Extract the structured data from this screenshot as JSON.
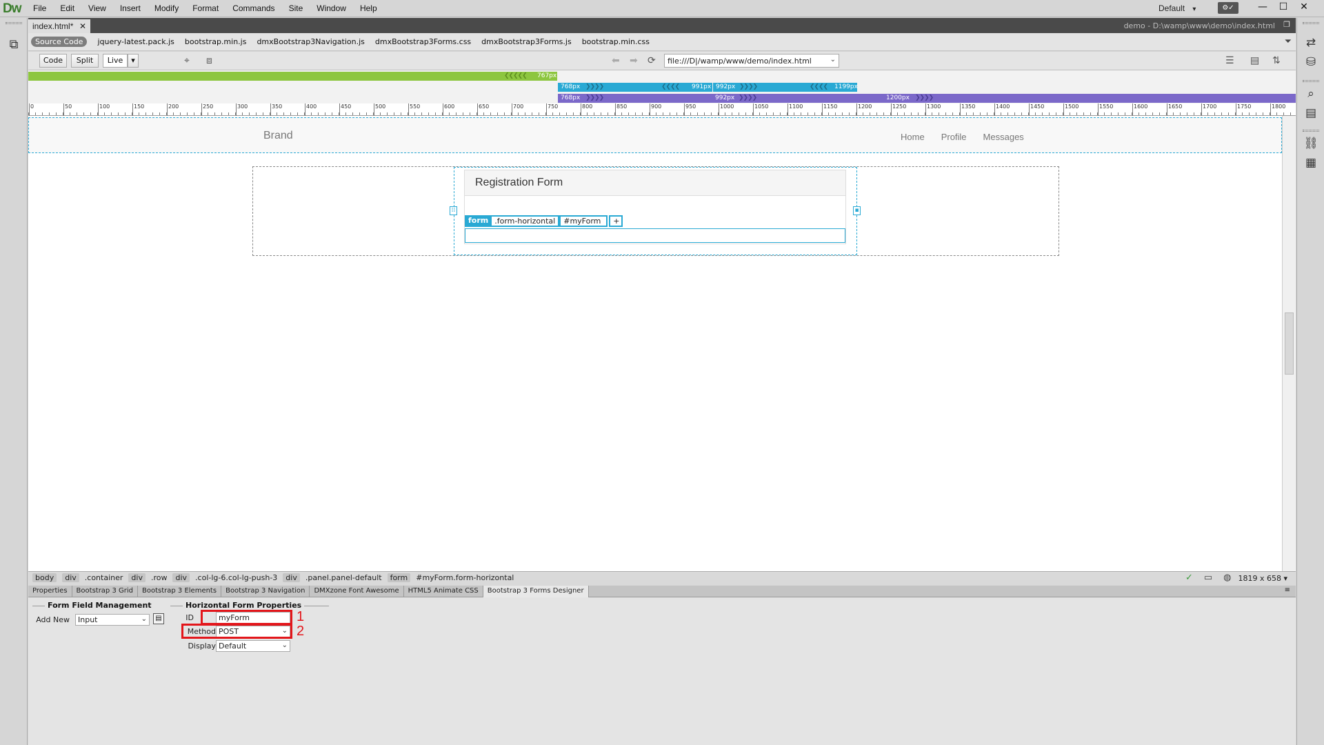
{
  "app": {
    "logo": "Dw",
    "menu": [
      "File",
      "Edit",
      "View",
      "Insert",
      "Modify",
      "Format",
      "Commands",
      "Site",
      "Window",
      "Help"
    ],
    "workspace": "Default",
    "workspace_caret": "▾",
    "window_controls": [
      "—",
      "☐",
      "✕"
    ]
  },
  "document": {
    "tab_name": "index.html*",
    "tab_close": "✕",
    "site_path": "demo - D:\\wamp\\www\\demo\\index.html",
    "related_files": [
      "Source Code",
      "jquery-latest.pack.js",
      "bootstrap.min.js",
      "dmxBootstrap3Navigation.js",
      "dmxBootstrap3Forms.css",
      "dmxBootstrap3Forms.js",
      "bootstrap.min.css"
    ]
  },
  "toolbar": {
    "code": "Code",
    "split": "Split",
    "live": "Live",
    "live_caret": "▾",
    "address": "file:///D|/wamp/www/demo/index.html",
    "address_caret": "⌄"
  },
  "media_queries": {
    "green_label": "767px",
    "blue_labels": [
      "768px",
      "991px",
      "992px",
      "1199px"
    ],
    "purple_labels": [
      "768px",
      "992px",
      "1200px"
    ]
  },
  "ruler": [
    "0",
    "50",
    "100",
    "150",
    "200",
    "250",
    "300",
    "350",
    "400",
    "450",
    "500",
    "550",
    "600",
    "650",
    "700",
    "750",
    "800",
    "850",
    "900",
    "950",
    "1000",
    "1050",
    "1100",
    "1150",
    "1200",
    "1250",
    "1300",
    "1350",
    "1400",
    "1450",
    "1500",
    "1550",
    "1600",
    "1650",
    "1700",
    "1750",
    "1800"
  ],
  "page": {
    "brand": "Brand",
    "nav_links": [
      "Home",
      "Profile",
      "Messages"
    ],
    "panel_title": "Registration Form",
    "form_tag": "form",
    "form_class": ".form-horizontal",
    "form_id": "#myForm",
    "form_add": "+"
  },
  "tag_selector": [
    {
      "text": "body",
      "el": true
    },
    {
      "text": "div",
      "el": true
    },
    {
      "text": ".container",
      "el": false
    },
    {
      "text": "div",
      "el": true
    },
    {
      "text": ".row",
      "el": false
    },
    {
      "text": "div",
      "el": true
    },
    {
      "text": ".col-lg-6.col-lg-push-3",
      "el": false
    },
    {
      "text": "div",
      "el": true
    },
    {
      "text": ".panel.panel-default",
      "el": false
    },
    {
      "text": "form",
      "el": true
    },
    {
      "text": "#myForm.form-horizontal",
      "el": false
    }
  ],
  "status": {
    "window_size": "1819 x 658 ▾"
  },
  "property_inspector": {
    "tabs": [
      "Properties",
      "Bootstrap 3 Grid",
      "Bootstrap 3 Elements",
      "Bootstrap 3 Navigation",
      "DMXzone Font Awesome",
      "HTML5 Animate CSS",
      "Bootstrap 3 Forms Designer"
    ],
    "active_tab": 6,
    "field_mgmt_title": "Form Field Management",
    "add_new_label": "Add New",
    "add_new_value": "Input",
    "horizontal_title": "Horizontal Form Properties",
    "id_label": "ID",
    "id_value": "myForm",
    "method_label": "Method",
    "method_value": "POST",
    "display_label": "Display",
    "display_value": "Default",
    "callouts": [
      "1",
      "2"
    ]
  },
  "colors": {
    "mq_green": "#8dc63f",
    "mq_blue": "#29a9d4",
    "mq_purple": "#7b68c9",
    "highlight": "#e3161b",
    "dw_logo": "#3a7d2c"
  }
}
